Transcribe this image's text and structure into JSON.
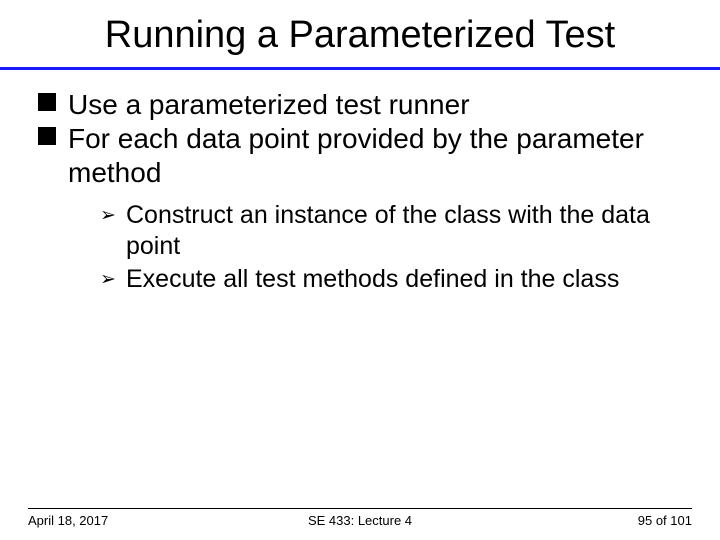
{
  "title": "Running a Parameterized Test",
  "bullets": [
    {
      "text": "Use a parameterized test runner"
    },
    {
      "text": "For each data point provided by the parameter method",
      "children": [
        "Construct an instance of the class with the data point",
        "Execute all test methods defined in the class"
      ]
    }
  ],
  "footer": {
    "date": "April 18, 2017",
    "course": "SE 433: Lecture 4",
    "page_current": "95",
    "page_of": " of ",
    "page_total": "101"
  },
  "colors": {
    "rule": "#1a1aff"
  }
}
